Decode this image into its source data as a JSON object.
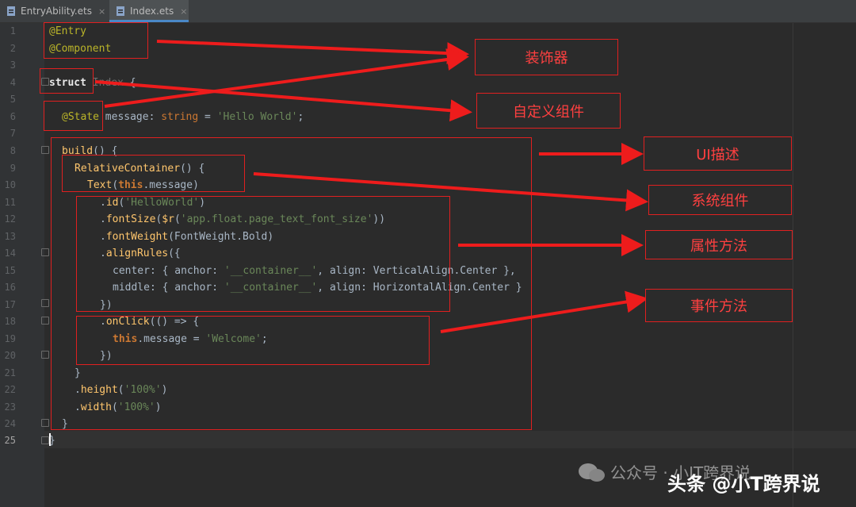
{
  "tabs": [
    {
      "label": "EntryAbility.ets",
      "close": "×",
      "active": false
    },
    {
      "label": "Index.ets",
      "close": "×",
      "active": true
    }
  ],
  "line_numbers": [
    "1",
    "2",
    "3",
    "4",
    "5",
    "6",
    "7",
    "8",
    "9",
    "10",
    "11",
    "12",
    "13",
    "14",
    "15",
    "16",
    "17",
    "18",
    "19",
    "20",
    "21",
    "22",
    "23",
    "24",
    "25"
  ],
  "code": {
    "l1": "@Entry",
    "l2": "@Component",
    "l4_kw": "struct",
    "l4_name": " Index ",
    "l4_brace": "{",
    "l6_dec": "@State",
    "l6_var": " message: ",
    "l6_type": "string",
    "l6_eq": " = ",
    "l6_str": "'Hello World'",
    "l6_end": ";",
    "l8_fn": "build",
    "l8_rest": "() {",
    "l9_fn": "RelativeContainer",
    "l9_rest": "() {",
    "l10_fn": "Text",
    "l10_open": "(",
    "l10_this": "this",
    "l10_rest": ".message)",
    "l11_pre": ".",
    "l11_fn": "id",
    "l11_open": "(",
    "l11_str": "'HelloWorld'",
    "l11_close": ")",
    "l12_pre": ".",
    "l12_fn": "fontSize",
    "l12_open": "(",
    "l12_r": "$r",
    "l12_open2": "(",
    "l12_str": "'app.float.page_text_font_size'",
    "l12_close": "))",
    "l13_pre": ".",
    "l13_fn": "fontWeight",
    "l13_rest": "(FontWeight.Bold)",
    "l14_pre": ".",
    "l14_fn": "alignRules",
    "l14_rest": "({",
    "l15_a": "center: { anchor: ",
    "l15_str": "'__container__'",
    "l15_b": ", align: VerticalAlign.Center },",
    "l16_a": "middle: { anchor: ",
    "l16_str": "'__container__'",
    "l16_b": ", align: HorizontalAlign.Center }",
    "l17": "})",
    "l18_pre": ".",
    "l18_fn": "onClick",
    "l18_rest": "(() => {",
    "l19_this": "this",
    "l19_mid": ".message = ",
    "l19_str": "'Welcome'",
    "l19_end": ";",
    "l20": "})",
    "l21": "}",
    "l22_pre": ".",
    "l22_fn": "height",
    "l22_open": "(",
    "l22_str": "'100%'",
    "l22_close": ")",
    "l23_pre": ".",
    "l23_fn": "width",
    "l23_open": "(",
    "l23_str": "'100%'",
    "l23_close": ")",
    "l24": "}",
    "l25": "}"
  },
  "annotations": {
    "decorator": "装饰器",
    "custom_component": "自定义组件",
    "ui_description": "UI描述",
    "system_component": "系统组件",
    "attribute_method": "属性方法",
    "event_method": "事件方法"
  },
  "watermark": {
    "wechat": "公众号 · 小IT跨界说",
    "toutiao": "头条 @小T跨界说"
  },
  "colors": {
    "annotation_red": "#e02020",
    "editor_bg": "#2b2b2b",
    "keyword": "#cc7832",
    "annotation_yellow": "#bbb529",
    "string_green": "#6a8759"
  }
}
